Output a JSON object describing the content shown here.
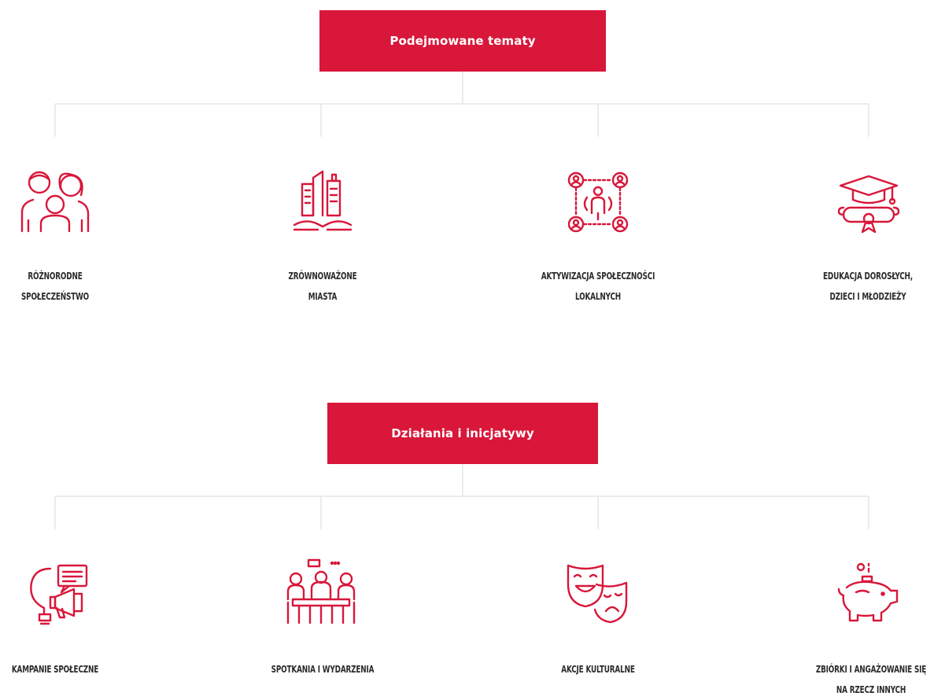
{
  "sections": {
    "topics": {
      "title": "Podejmowane tematy",
      "items": [
        {
          "line1": "Różnorodne",
          "line2": "społeczeństwo",
          "icon": "family-icon"
        },
        {
          "line1": "Zrównoważone",
          "line2": "miasta",
          "icon": "sustainable-city-icon"
        },
        {
          "line1": "Aktywizacja społeczności",
          "line2": "lokalnych",
          "icon": "community-network-icon"
        },
        {
          "line1": "Edukacja dorosłych,",
          "line2": "dzieci i młodzieży",
          "icon": "graduation-diploma-icon"
        }
      ]
    },
    "actions": {
      "title": "Działania i inicjatywy",
      "items": [
        {
          "line1": "Kampanie społeczne",
          "line2": "",
          "icon": "megaphone-idea-icon"
        },
        {
          "line1": "Spotkania i wydarzenia",
          "line2": "",
          "icon": "meeting-icon"
        },
        {
          "line1": "Akcje kulturalne",
          "line2": "",
          "icon": "theater-masks-icon"
        },
        {
          "line1": "Zbiórki i angażowanie się",
          "line2": "na rzecz innych",
          "icon": "piggy-bank-icon"
        }
      ]
    }
  },
  "colors": {
    "accent": "#d8173a",
    "text": "#2b2b2b",
    "connector": "#e6e6e6"
  }
}
